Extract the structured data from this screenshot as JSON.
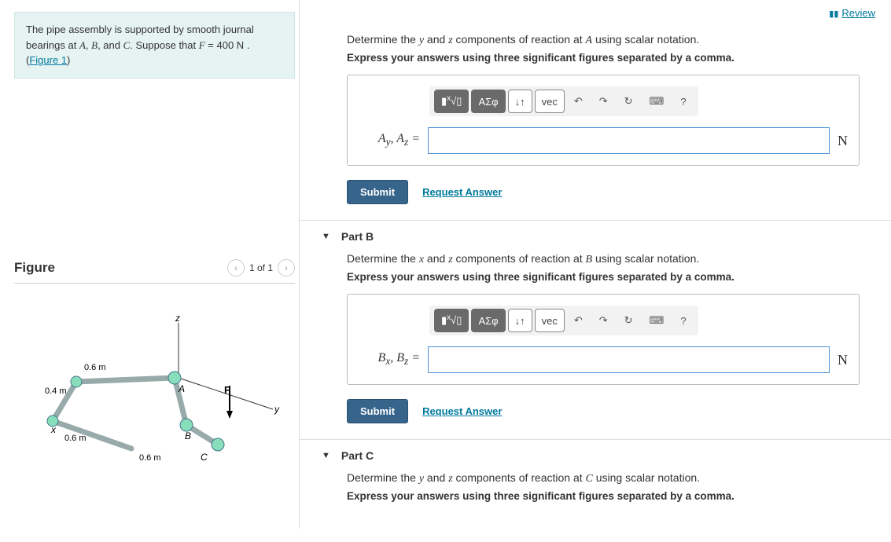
{
  "problem": {
    "text_prefix": "The pipe assembly is supported by smooth journal bearings at ",
    "points": "A, B, and C",
    "text_mid": ". Suppose that ",
    "force_var": "F",
    "force_val": " = 400 N",
    "text_end": " .",
    "figure_link": "Figure 1"
  },
  "figure": {
    "heading": "Figure",
    "counter": "1 of 1",
    "labels": {
      "z": "z",
      "y": "y",
      "x": "x",
      "A": "A",
      "B": "B",
      "C": "C",
      "F": "F",
      "d1": "0.6 m",
      "d2": "0.4 m",
      "d3": "0.6 m",
      "d4": "0.6 m"
    }
  },
  "review_label": "Review",
  "toolbar": {
    "templates_icon": "▮√▯",
    "greek": "ΑΣφ",
    "subsup": "↓↑",
    "vec": "vec",
    "undo": "↶",
    "redo": "↷",
    "reset": "↻",
    "keyboard": "⌨",
    "help": "?"
  },
  "partA": {
    "prompt": "Determine the y and z components of reaction at A using scalar notation.",
    "instruct": "Express your answers using three significant figures separated by a comma.",
    "lhs_html": "A_y, A_z =",
    "unit": "N",
    "submit": "Submit",
    "request": "Request Answer"
  },
  "partB": {
    "title": "Part B",
    "prompt": "Determine the x and z components of reaction at B using scalar notation.",
    "instruct": "Express your answers using three significant figures separated by a comma.",
    "lhs_html": "B_x, B_z =",
    "unit": "N",
    "submit": "Submit",
    "request": "Request Answer"
  },
  "partC": {
    "title": "Part C",
    "prompt": "Determine the y and z components of reaction at C using scalar notation.",
    "instruct": "Express your answers using three significant figures separated by a comma."
  }
}
